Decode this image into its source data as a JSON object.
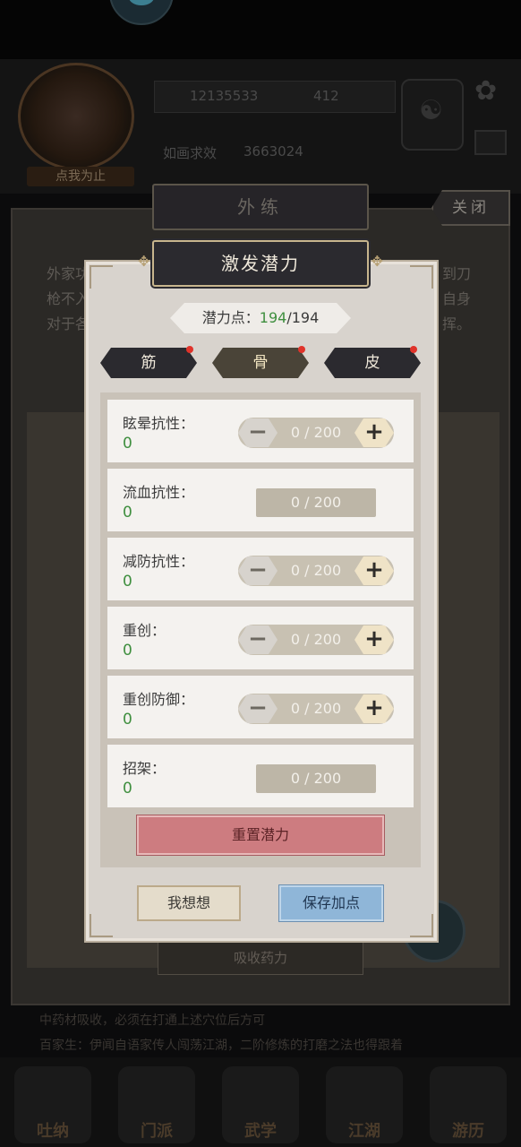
{
  "background": {
    "portrait_label": "点我为止",
    "stat_line_1_num": "12135533",
    "stat_line_1_num2": "412",
    "stat_line_2_label": "如画求效",
    "stat_line_2_num": "3663024",
    "desc_lines": [
      "外家功",
      "枪不入",
      "对于各"
    ],
    "desc_right": [
      "到刀",
      "自身",
      "挥。"
    ],
    "absorb_label": "吸收药力",
    "bottom_line_1": "中药材吸收，必须在打通上述穴位后方可",
    "bottom_line_2": "百家生：伊闻自语家传人闯荡江湖，二阶修炼的打磨之法也得跟着",
    "nav": [
      "吐纳",
      "门派",
      "武学",
      "江湖",
      "游历"
    ]
  },
  "outer_title": "外练",
  "close_label": "关闭",
  "modal": {
    "title": "激发潜力",
    "points_label": "潜力点：",
    "points_current": "194",
    "points_total": "/194",
    "tabs": [
      {
        "label": "筋",
        "active": false
      },
      {
        "label": "骨",
        "active": true
      },
      {
        "label": "皮",
        "active": false
      }
    ],
    "stats": [
      {
        "name": "眩晕抗性：",
        "value": "0",
        "progress": "0 / 200",
        "stepper": true
      },
      {
        "name": "流血抗性：",
        "value": "0",
        "progress": "0 / 200",
        "stepper": false
      },
      {
        "name": "减防抗性：",
        "value": "0",
        "progress": "0 / 200",
        "stepper": true
      },
      {
        "name": "重创：",
        "value": "0",
        "progress": "0 / 200",
        "stepper": true
      },
      {
        "name": "重创防御：",
        "value": "0",
        "progress": "0 / 200",
        "stepper": true
      },
      {
        "name": "招架：",
        "value": "0",
        "progress": "0 / 200",
        "stepper": false
      }
    ],
    "minus_symbol": "−",
    "plus_symbol": "+",
    "reset_label": "重置潜力",
    "think_label": "我想想",
    "save_label": "保存加点"
  },
  "colors": {
    "green_value": "#3f8f3f",
    "reset_red": "#cd7c80",
    "save_blue": "#8fb6d8",
    "dark_plate": "#2b2a2f"
  }
}
